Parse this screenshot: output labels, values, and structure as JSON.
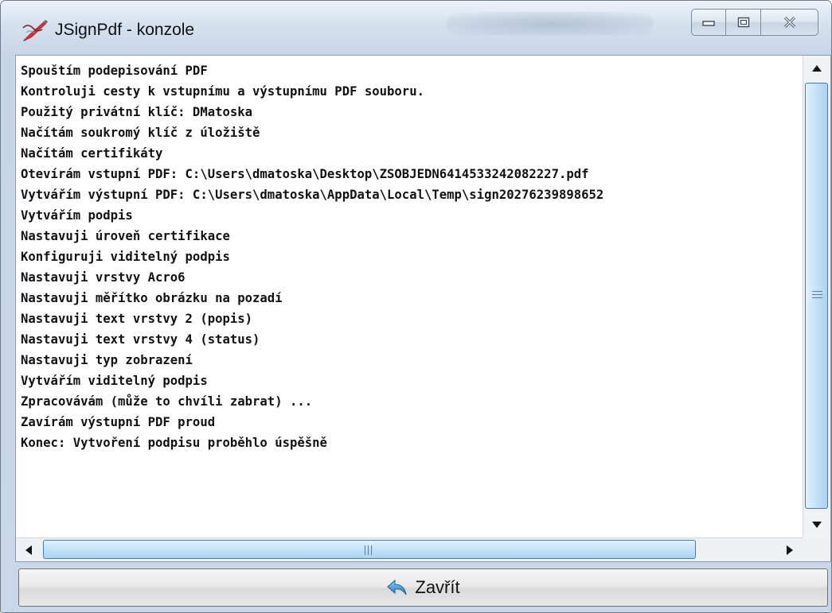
{
  "window": {
    "title": "JSignPdf - konzole"
  },
  "log": {
    "lines": [
      "Spouštím podepisování PDF",
      "Kontroluji cesty k vstupnímu a výstupnímu PDF souboru.",
      "Použitý privátní klíč: DMatoska",
      "Načítám soukromý klíč z úložiště",
      "Načítám certifikáty",
      "Otevírám vstupní PDF: C:\\Users\\dmatoska\\Desktop\\ZSOBJEDN6414533242082227.pdf",
      "Vytvářím výstupní PDF: C:\\Users\\dmatoska\\AppData\\Local\\Temp\\sign20276239898652",
      "Vytvářím podpis",
      "Nastavuji úroveň certifikace",
      "Konfiguruji viditelný podpis",
      "Nastavuji vrstvy Acro6",
      "Nastavuji měřítko obrázku na pozadí",
      "Nastavuji text vrstvy 2 (popis)",
      "Nastavuji text vrstvy 4 (status)",
      "Nastavuji typ zobrazení",
      "Vytvářím viditelný podpis",
      "Zpracovávám (může to chvíli zabrat) ...",
      "Zavírám výstupní PDF proud",
      "Konec: Vytvoření podpisu proběhlo úspěšně"
    ]
  },
  "buttons": {
    "close_label": "Zavřít"
  },
  "icons": {
    "app": "pen-icon",
    "close_button": "undo-arrow-icon"
  },
  "colors": {
    "scroll_thumb": "#c4e2f7",
    "scroll_border": "#3c7fb1",
    "text": "#111111"
  }
}
